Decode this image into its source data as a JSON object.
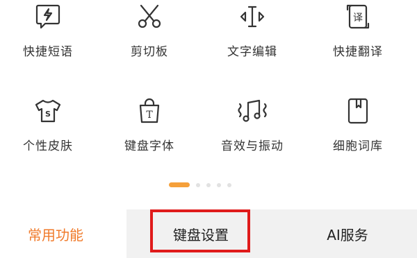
{
  "grid": {
    "row1": [
      {
        "label": "快捷短语",
        "icon": "lightning-chat-icon"
      },
      {
        "label": "剪切板",
        "icon": "scissors-icon"
      },
      {
        "label": "文字编辑",
        "icon": "text-cursor-icon"
      },
      {
        "label": "快捷翻译",
        "icon": "translate-icon"
      }
    ],
    "row2": [
      {
        "label": "个性皮肤",
        "icon": "tshirt-icon"
      },
      {
        "label": "键盘字体",
        "icon": "font-bag-icon"
      },
      {
        "label": "音效与振动",
        "icon": "music-vibration-icon"
      },
      {
        "label": "细胞词库",
        "icon": "dictionary-book-icon"
      }
    ]
  },
  "pager": {
    "pages": 5,
    "active": 0
  },
  "tabs": {
    "common": "常用功能",
    "keyboard": "键盘设置",
    "ai": "AI服务"
  },
  "colors": {
    "accent": "#f07a2a",
    "pager_active": "#f5a03a",
    "highlight_box": "#e01b1b",
    "icon_stroke": "#333333"
  }
}
